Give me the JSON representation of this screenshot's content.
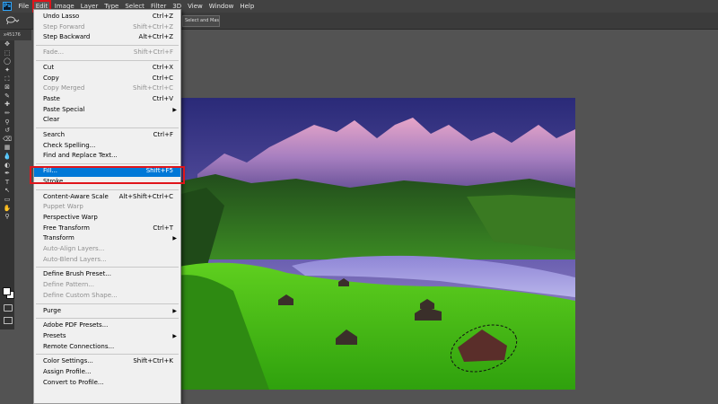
{
  "menubar": {
    "logo": "Ps",
    "items": [
      "File",
      "Edit",
      "Image",
      "Layer",
      "Type",
      "Select",
      "Filter",
      "3D",
      "View",
      "Window",
      "Help"
    ],
    "active_index": 1
  },
  "options_bar": {
    "select_and_mask_button": "Select and Mask..."
  },
  "document_tab": {
    "label": "x45176"
  },
  "edit_menu": {
    "items": [
      {
        "label": "Undo Lasso",
        "shortcut": "Ctrl+Z",
        "disabled": false
      },
      {
        "label": "Step Forward",
        "shortcut": "Shift+Ctrl+Z",
        "disabled": true
      },
      {
        "label": "Step Backward",
        "shortcut": "Alt+Ctrl+Z",
        "disabled": false
      },
      {
        "sep": true
      },
      {
        "label": "Fade...",
        "shortcut": "Shift+Ctrl+F",
        "disabled": true
      },
      {
        "sep": true
      },
      {
        "label": "Cut",
        "shortcut": "Ctrl+X",
        "disabled": false
      },
      {
        "label": "Copy",
        "shortcut": "Ctrl+C",
        "disabled": false
      },
      {
        "label": "Copy Merged",
        "shortcut": "Shift+Ctrl+C",
        "disabled": true
      },
      {
        "label": "Paste",
        "shortcut": "Ctrl+V",
        "disabled": false
      },
      {
        "label": "Paste Special",
        "shortcut": "",
        "disabled": false,
        "submenu": true
      },
      {
        "label": "Clear",
        "shortcut": "",
        "disabled": false
      },
      {
        "sep": true
      },
      {
        "label": "Search",
        "shortcut": "Ctrl+F",
        "disabled": false
      },
      {
        "label": "Check Spelling...",
        "shortcut": "",
        "disabled": false
      },
      {
        "label": "Find and Replace Text...",
        "shortcut": "",
        "disabled": false
      },
      {
        "sep": true
      },
      {
        "label": "Fill...",
        "shortcut": "Shift+F5",
        "disabled": false,
        "highlighted": true
      },
      {
        "label": "Stroke...",
        "shortcut": "",
        "disabled": false
      },
      {
        "sep": true
      },
      {
        "label": "Content-Aware Scale",
        "shortcut": "Alt+Shift+Ctrl+C",
        "disabled": false
      },
      {
        "label": "Puppet Warp",
        "shortcut": "",
        "disabled": true
      },
      {
        "label": "Perspective Warp",
        "shortcut": "",
        "disabled": false
      },
      {
        "label": "Free Transform",
        "shortcut": "Ctrl+T",
        "disabled": false
      },
      {
        "label": "Transform",
        "shortcut": "",
        "disabled": false,
        "submenu": true
      },
      {
        "label": "Auto-Align Layers...",
        "shortcut": "",
        "disabled": true
      },
      {
        "label": "Auto-Blend Layers...",
        "shortcut": "",
        "disabled": true
      },
      {
        "sep": true
      },
      {
        "label": "Define Brush Preset...",
        "shortcut": "",
        "disabled": false
      },
      {
        "label": "Define Pattern...",
        "shortcut": "",
        "disabled": true
      },
      {
        "label": "Define Custom Shape...",
        "shortcut": "",
        "disabled": true
      },
      {
        "sep": true
      },
      {
        "label": "Purge",
        "shortcut": "",
        "disabled": false,
        "submenu": true
      },
      {
        "sep": true
      },
      {
        "label": "Adobe PDF Presets...",
        "shortcut": "",
        "disabled": false
      },
      {
        "label": "Presets",
        "shortcut": "",
        "disabled": false,
        "submenu": true
      },
      {
        "label": "Remote Connections...",
        "shortcut": "",
        "disabled": false
      },
      {
        "sep": true
      },
      {
        "label": "Color Settings...",
        "shortcut": "Shift+Ctrl+K",
        "disabled": false
      },
      {
        "label": "Assign Profile...",
        "shortcut": "",
        "disabled": false
      },
      {
        "label": "Convert to Profile...",
        "shortcut": "",
        "disabled": false
      }
    ]
  },
  "toolbar": {
    "tools": [
      "move-tool",
      "marquee-tool",
      "lasso-tool",
      "quick-select-tool",
      "crop-tool",
      "frame-tool",
      "eyedropper-tool",
      "healing-brush-tool",
      "brush-tool",
      "clone-stamp-tool",
      "history-brush-tool",
      "eraser-tool",
      "gradient-tool",
      "blur-tool",
      "dodge-tool",
      "pen-tool",
      "type-tool",
      "path-select-tool",
      "rectangle-tool",
      "hand-tool",
      "zoom-tool"
    ]
  },
  "colors": {
    "menu_highlight": "#0078d7",
    "callout_red": "#e0151b",
    "workspace": "#535353"
  }
}
